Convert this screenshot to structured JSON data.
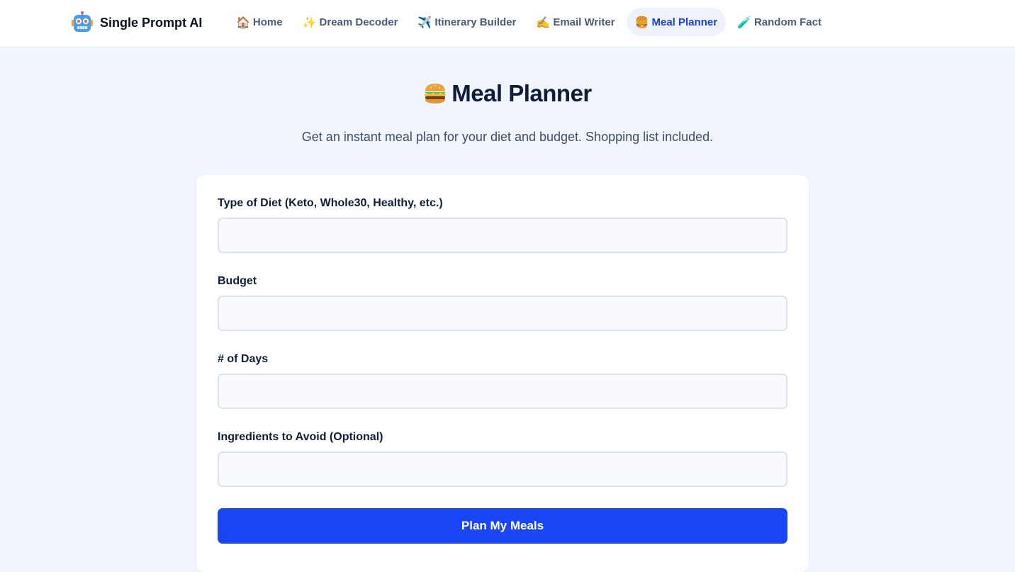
{
  "brand": {
    "name": "Single Prompt AI",
    "icon": "robot-icon"
  },
  "nav": {
    "items": [
      {
        "emoji": "🏠",
        "label": "Home",
        "active": false
      },
      {
        "emoji": "✨",
        "label": "Dream Decoder",
        "active": false
      },
      {
        "emoji": "✈️",
        "label": "Itinerary Builder",
        "active": false
      },
      {
        "emoji": "✍️",
        "label": "Email Writer",
        "active": false
      },
      {
        "emoji": "🍔",
        "label": "Meal Planner",
        "active": true
      },
      {
        "emoji": "🧪",
        "label": "Random Fact",
        "active": false
      }
    ]
  },
  "page": {
    "title": "Meal Planner",
    "title_icon": "burger-icon",
    "subtitle": "Get an instant meal plan for your diet and budget. Shopping list included."
  },
  "form": {
    "diet_label": "Type of Diet (Keto, Whole30, Healthy, etc.)",
    "diet_value": "",
    "budget_label": "Budget",
    "budget_value": "",
    "days_label": "# of Days",
    "days_value": "",
    "avoid_label": "Ingredients to Avoid (Optional)",
    "avoid_value": "",
    "submit_label": "Plan My Meals"
  },
  "colors": {
    "accent": "#1a45f5",
    "nav_active_bg": "#eef2fc",
    "nav_active_text": "#1a3fd6",
    "page_bg": "#f1f5fd"
  }
}
